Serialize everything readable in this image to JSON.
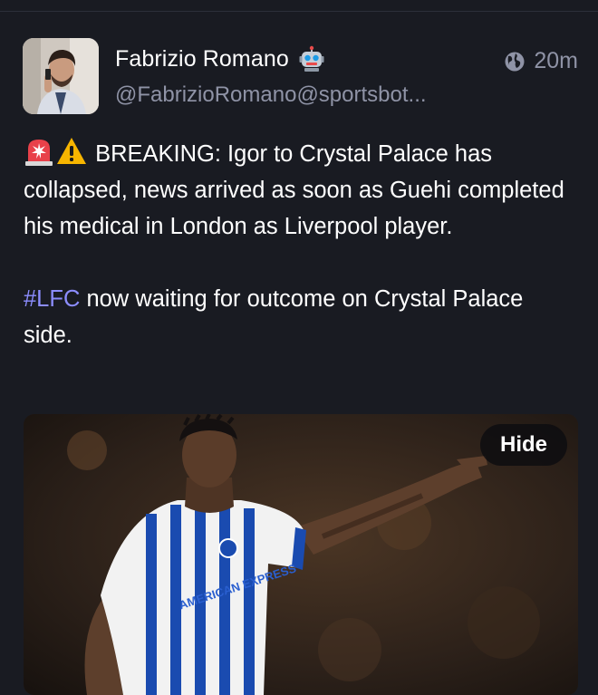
{
  "post": {
    "author": {
      "display_name": "Fabrizio Romano",
      "bot_badge_icon": "robot-icon",
      "handle": "@FabrizioRomano@sportsbot..."
    },
    "visibility_icon": "globe-icon",
    "timestamp": "20m",
    "content": {
      "emoji": [
        "rotating-light-icon",
        "warning-icon"
      ],
      "paragraph1": "BREAKING: Igor to Crystal Palace has collapsed, news arrived as soon as Guehi completed his medical in London as Liverpool player.",
      "hashtag": "#LFC",
      "paragraph2_rest": " now waiting for outcome on Crystal Palace side."
    },
    "media": {
      "hide_label": "Hide",
      "shirt_sponsor": "AMERICAN EXPRESS"
    }
  },
  "colors": {
    "background": "#191b22",
    "secondary_text": "#8f93a6",
    "hashtag": "#8c8dff"
  }
}
